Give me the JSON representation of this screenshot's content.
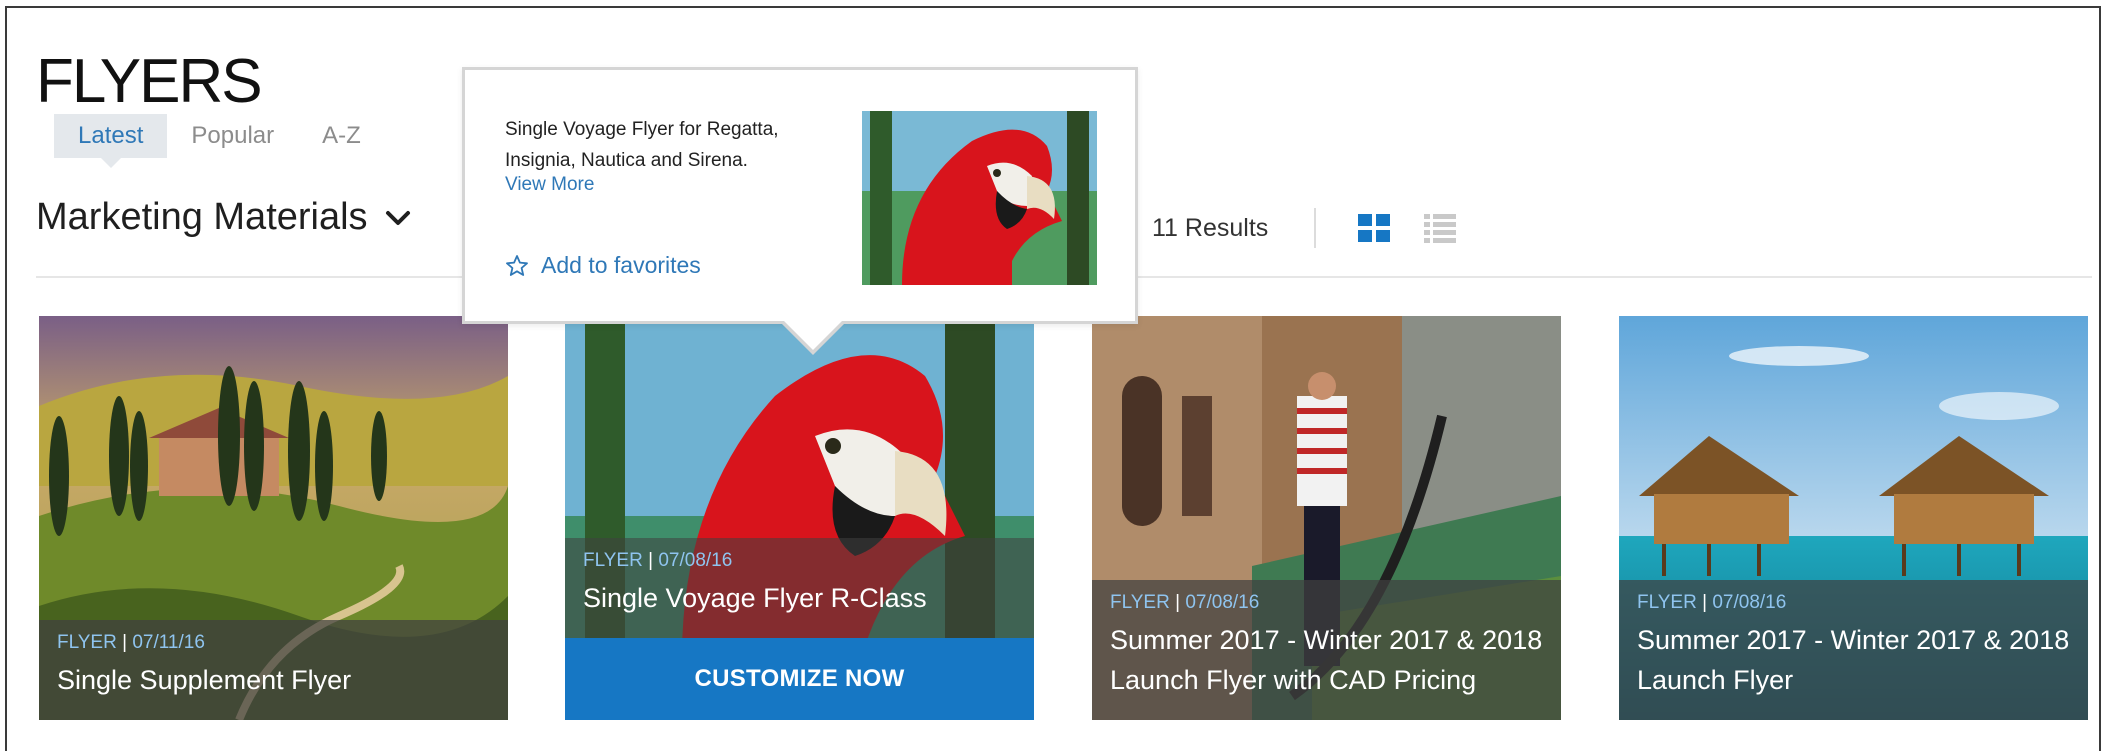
{
  "page": {
    "title": "FLYERS"
  },
  "tabs": [
    {
      "label": "Latest",
      "active": true
    },
    {
      "label": "Popular",
      "active": false
    },
    {
      "label": "A-Z",
      "active": false
    }
  ],
  "category": {
    "selected": "Marketing Materials",
    "icon": "chevron-down-icon"
  },
  "results": {
    "count_label": "11 Results",
    "view_modes": [
      "grid-view-icon",
      "list-view-icon"
    ],
    "active_view": "grid"
  },
  "popover": {
    "description": "Single Voyage Flyer for Regatta, Insignia, Nautica and Sirena.",
    "view_more": "View More",
    "favorite": "Add to favorites"
  },
  "cards": [
    {
      "type": "FLYER",
      "date": "07/11/16",
      "title": "Single Supplement Flyer",
      "image": "tuscany-landscape"
    },
    {
      "type": "FLYER",
      "date": "07/08/16",
      "title": "Single Voyage Flyer R-Class",
      "image": "red-macaw-parrot",
      "action": "CUSTOMIZE NOW"
    },
    {
      "type": "FLYER",
      "date": "07/08/16",
      "title": "Summer 2017 - Winter 2017 & 2018 Launch Flyer with CAD Pricing",
      "image": "venice-gondola"
    },
    {
      "type": "FLYER",
      "date": "07/08/16",
      "title": "Summer 2017 - Winter 2017 & 2018 Launch Flyer",
      "image": "overwater-bungalows"
    }
  ],
  "colors": {
    "accent": "#1677c4",
    "link": "#2f78b7",
    "meta": "#8fc4ef"
  },
  "separator": "|"
}
